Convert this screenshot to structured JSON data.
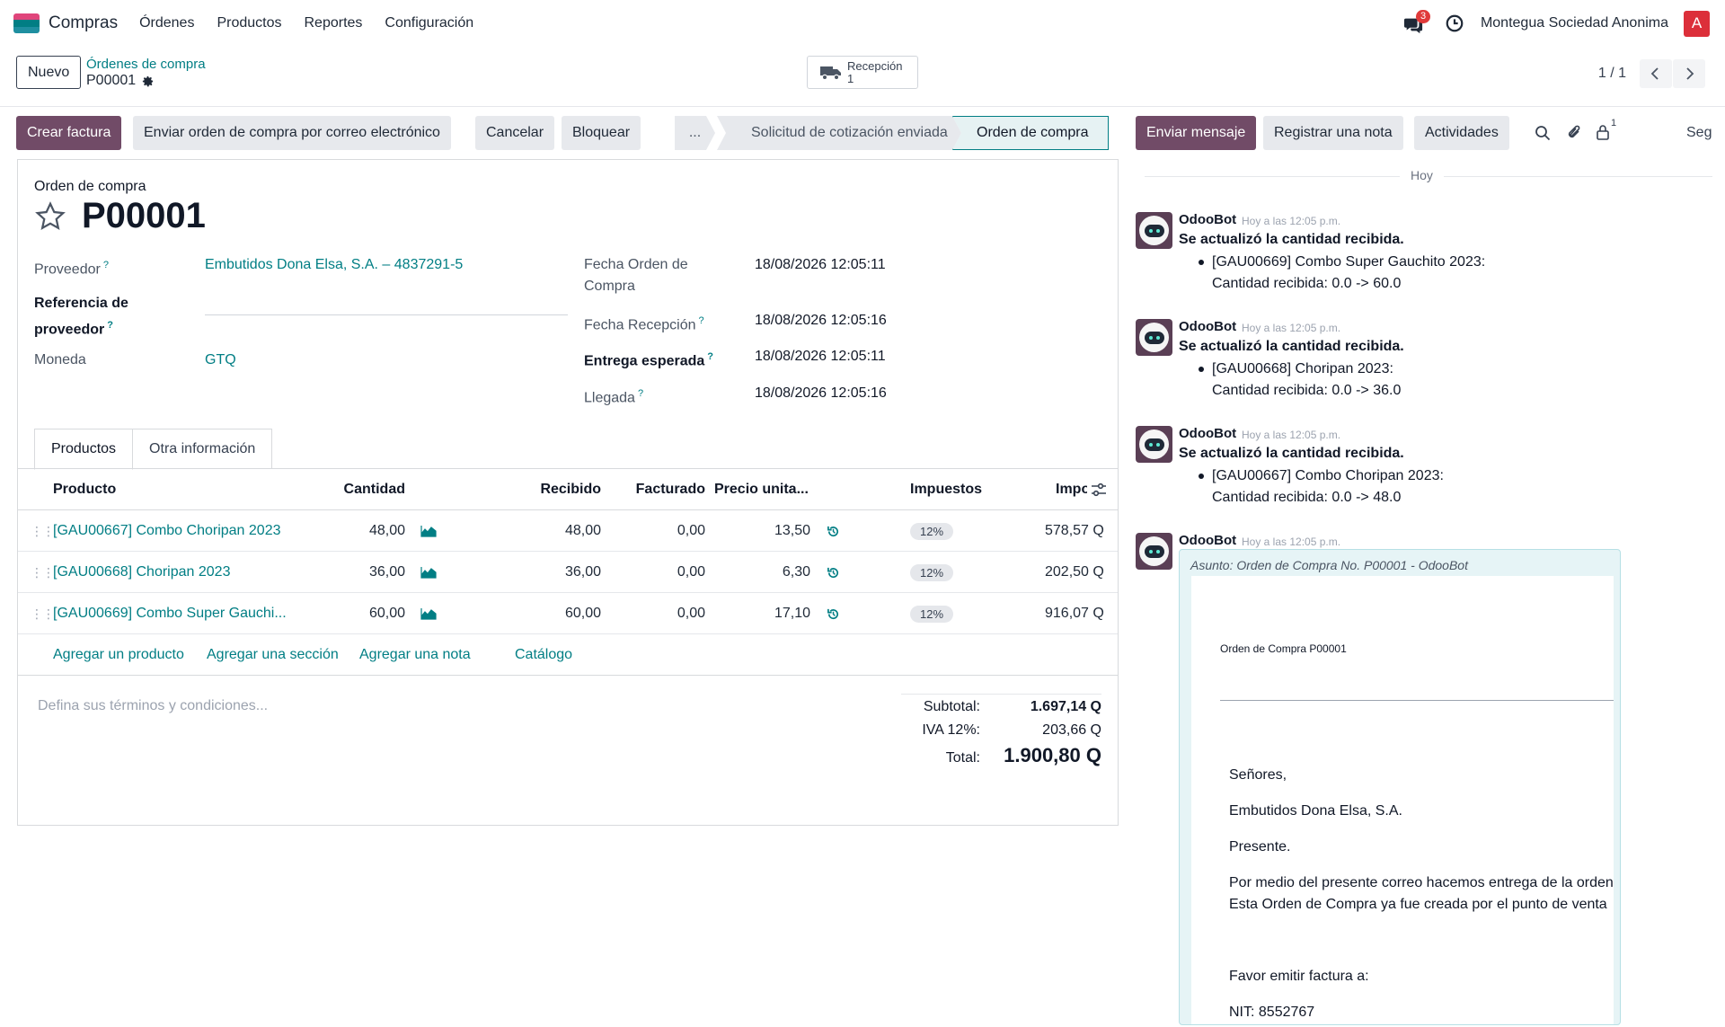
{
  "navbar": {
    "app_name": "Compras",
    "menu": [
      "Órdenes",
      "Productos",
      "Reportes",
      "Configuración"
    ],
    "messages_count": "3",
    "company": "Montegua Sociedad Anonima",
    "user_initial": "A",
    "brand_color": "#714b67",
    "link_color": "#017e84"
  },
  "control": {
    "new_button": "Nuevo",
    "breadcrumb_parent": "Órdenes de compra",
    "breadcrumb_current": "P00001",
    "smart_button": {
      "label": "Recepción",
      "count": "1"
    },
    "pager": "1 / 1"
  },
  "actions": {
    "create_invoice": "Crear factura",
    "send_email": "Enviar orden de compra por correo electrónico",
    "cancel": "Cancelar",
    "lock": "Bloquear"
  },
  "stages": {
    "more": "...",
    "sent": "Solicitud de cotización enviada",
    "active": "Orden de compra"
  },
  "form": {
    "type_label": "Orden de compra",
    "name": "P00001",
    "vendor_label": "Proveedor",
    "vendor_value": "Embutidos Dona Elsa, S.A. – 4837291-5",
    "vendor_ref_label_1": "Referencia de",
    "vendor_ref_label_2": "proveedor",
    "currency_label": "Moneda",
    "currency_value": "GTQ",
    "order_date_label_1": "Fecha Orden de",
    "order_date_label_2": "Compra",
    "order_date_value": "18/08/2026 12:05:11",
    "receipt_date_label": "Fecha Recepción",
    "receipt_date_value": "18/08/2026 12:05:16",
    "expected_label": "Entrega esperada",
    "expected_value": "18/08/2026 12:05:11",
    "arrival_label": "Llegada",
    "arrival_value": "18/08/2026 12:05:16",
    "help_mark": "?"
  },
  "tabs": [
    "Productos",
    "Otra información"
  ],
  "table": {
    "headers": {
      "product": "Producto",
      "qty": "Cantidad",
      "received": "Recibido",
      "billed": "Facturado",
      "price": "Precio unita...",
      "taxes": "Impuestos",
      "amount": "Impo"
    },
    "rows": [
      {
        "product": "[GAU00667] Combo Choripan 2023",
        "qty": "48,00",
        "received": "48,00",
        "billed": "0,00",
        "price": "13,50",
        "tax": "12%",
        "amount": "578,57 Q"
      },
      {
        "product": "[GAU00668] Choripan 2023",
        "qty": "36,00",
        "received": "36,00",
        "billed": "0,00",
        "price": "6,30",
        "tax": "12%",
        "amount": "202,50 Q"
      },
      {
        "product": "[GAU00669] Combo Super Gauchi...",
        "qty": "60,00",
        "received": "60,00",
        "billed": "0,00",
        "price": "17,10",
        "tax": "12%",
        "amount": "916,07 Q"
      }
    ],
    "add_product": "Agregar un producto",
    "add_section": "Agregar una sección",
    "add_note": "Agregar una nota",
    "catalog": "Catálogo"
  },
  "terms_placeholder": "Defina sus términos y condiciones...",
  "totals": {
    "subtotal_label": "Subtotal:",
    "subtotal_value": "1.697,14 Q",
    "tax_label": "IVA 12%:",
    "tax_value": "203,66 Q",
    "total_label": "Total:",
    "total_value": "1.900,80 Q"
  },
  "chatter": {
    "send_message": "Enviar mensaje",
    "log_note": "Registrar una nota",
    "activities": "Actividades",
    "followers_count": "1",
    "follow_cut": "Seg",
    "day": "Hoy",
    "messages": [
      {
        "author": "OdooBot",
        "time": "Hoy a las 12:05 p.m.",
        "head": "Se actualizó la cantidad recibida.",
        "line1": "[GAU00669] Combo Super Gauchito 2023:",
        "line2": "Cantidad recibida: 0.0 -> 60.0"
      },
      {
        "author": "OdooBot",
        "time": "Hoy a las 12:05 p.m.",
        "head": "Se actualizó la cantidad recibida.",
        "line1": "[GAU00668] Choripan 2023:",
        "line2": "Cantidad recibida: 0.0 -> 36.0"
      },
      {
        "author": "OdooBot",
        "time": "Hoy a las 12:05 p.m.",
        "head": "Se actualizó la cantidad recibida.",
        "line1": "[GAU00667] Combo Choripan 2023:",
        "line2": "Cantidad recibida: 0.0 -> 48.0"
      }
    ],
    "email": {
      "author": "OdooBot",
      "time": "Hoy a las 12:05 p.m.",
      "subject": "Asunto: Orden de Compra No. P00001 - OdooBot",
      "header": "Orden de Compra P00001",
      "p1": "Señores,",
      "p2": "Embutidos Dona Elsa, S.A.",
      "p3": "Presente.",
      "p4": "Por medio del presente correo hacemos entrega de la orden",
      "p5": "Esta Orden de Compra ya fue creada por el punto de venta",
      "p6": "Favor emitir factura a:",
      "p7": "NIT: 8552767"
    }
  }
}
